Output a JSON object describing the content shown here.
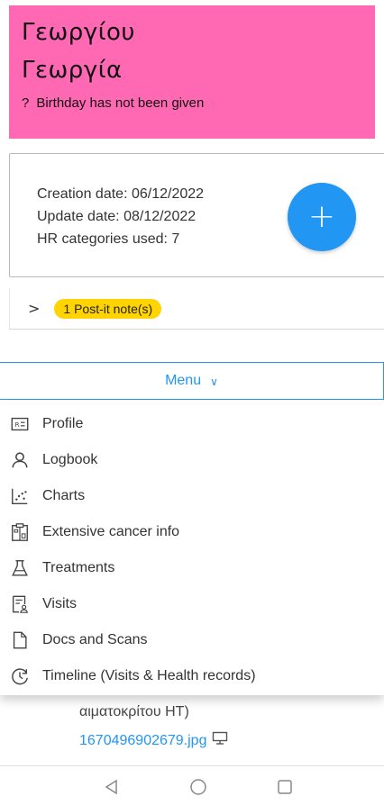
{
  "header": {
    "surname": "Γεωργίου",
    "first_name": "Γεωργία",
    "birthday_icon": "?",
    "birthday_text": "Birthday has not been given",
    "bg_color": "#ff69b4"
  },
  "info": {
    "creation": "Creation date: 06/12/2022",
    "update": "Update date: 08/12/2022",
    "hr_categories": "HR categories used: 7",
    "add_button_glyph": "+",
    "accent": "#2196f3"
  },
  "postit": {
    "chevron": ">",
    "badge": "1 Post-it note(s)",
    "badge_color": "#ffd400"
  },
  "menu": {
    "label": "Menu",
    "caret": "∨",
    "items": [
      {
        "label": "Profile",
        "icon": "id-card-icon"
      },
      {
        "label": "Logbook",
        "icon": "person-icon"
      },
      {
        "label": "Charts",
        "icon": "scatter-chart-icon"
      },
      {
        "label": "Extensive cancer info",
        "icon": "clipboard-icon"
      },
      {
        "label": "Treatments",
        "icon": "flask-icon"
      },
      {
        "label": "Visits",
        "icon": "document-person-icon"
      },
      {
        "label": "Docs and Scans",
        "icon": "file-icon"
      },
      {
        "label": "Timeline (Visits & Health records)",
        "icon": "clock-history-icon"
      }
    ]
  },
  "underlay": {
    "text_line": "αιματοκρίτου ΗΤ)",
    "file_link": "1670496902679.jpg"
  }
}
